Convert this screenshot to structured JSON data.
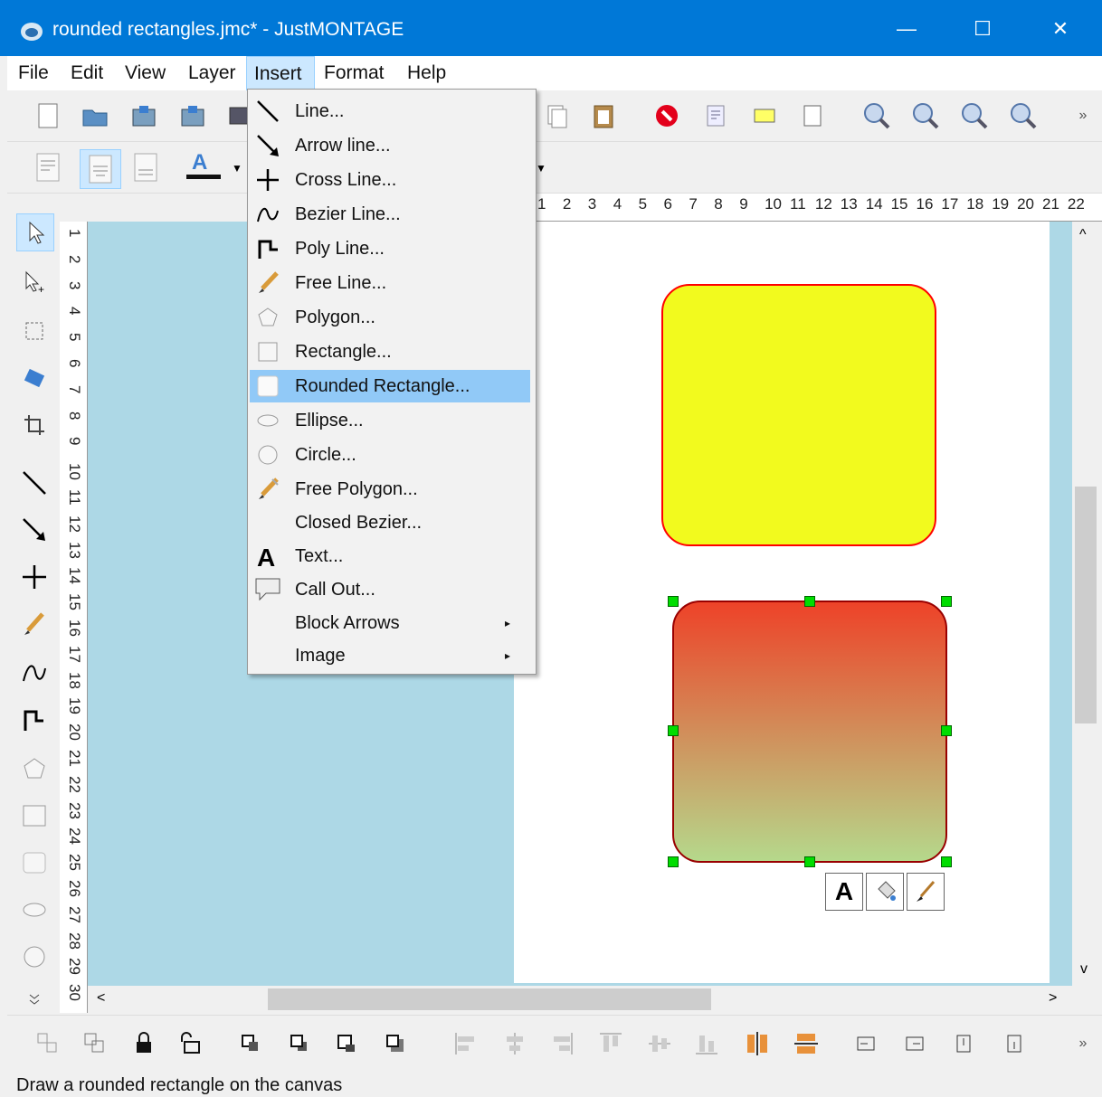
{
  "window": {
    "title": "rounded rectangles.jmc* - JustMONTAGE",
    "minimize": "—",
    "maximize": "☐",
    "close": "✕"
  },
  "menubar": {
    "items": [
      "File",
      "Edit",
      "View",
      "Layer",
      "Insert",
      "Format",
      "Help"
    ],
    "active": "Insert"
  },
  "insert_menu": {
    "items": [
      {
        "label": "Line...",
        "icon": "line-icon"
      },
      {
        "label": "Arrow line...",
        "icon": "arrow-line-icon"
      },
      {
        "label": "Cross Line...",
        "icon": "cross-line-icon"
      },
      {
        "label": "Bezier Line...",
        "icon": "bezier-line-icon"
      },
      {
        "label": "Poly Line...",
        "icon": "poly-line-icon"
      },
      {
        "label": "Free Line...",
        "icon": "pencil-icon"
      },
      {
        "label": "Polygon...",
        "icon": "polygon-icon"
      },
      {
        "label": "Rectangle...",
        "icon": "rectangle-icon"
      },
      {
        "label": "Rounded Rectangle...",
        "icon": "rounded-rectangle-icon"
      },
      {
        "label": "Ellipse...",
        "icon": "ellipse-icon"
      },
      {
        "label": "Circle...",
        "icon": "circle-icon"
      },
      {
        "label": "Free Polygon...",
        "icon": "free-polygon-icon"
      },
      {
        "label": "Closed Bezier...",
        "icon": ""
      },
      {
        "label": "Text...",
        "icon": "text-icon"
      },
      {
        "label": "Call Out...",
        "icon": "callout-icon"
      },
      {
        "label": "Block Arrows",
        "icon": ""
      },
      {
        "label": "Image",
        "icon": ""
      }
    ],
    "highlighted": "Rounded Rectangle...",
    "submenu_arrow": "▸"
  },
  "toolbar": {
    "overflow": "»"
  },
  "canvas": {
    "shape1": {
      "fill": "#f2fa1e",
      "stroke": "#ff0000"
    },
    "shape2": {
      "gradient_top": "#ee4228",
      "gradient_bottom": "#b5d98c",
      "stroke": "#990000"
    },
    "text_tool_label": "A"
  },
  "scrollbars": {
    "up": "^",
    "down": "v",
    "left": "<",
    "right": ">"
  },
  "status": {
    "text": "Draw a rounded rectangle on the canvas"
  }
}
